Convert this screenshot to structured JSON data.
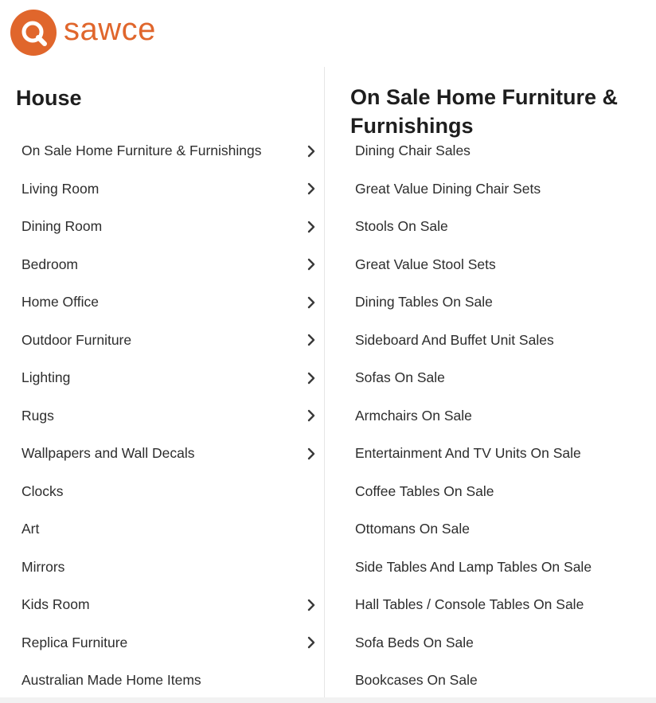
{
  "brand": {
    "name": "sawce",
    "accent": "#e0662c"
  },
  "left_panel": {
    "title": "House",
    "items": [
      {
        "label": "On Sale Home Furniture & Furnishings",
        "has_submenu": true
      },
      {
        "label": "Living Room",
        "has_submenu": true
      },
      {
        "label": "Dining Room",
        "has_submenu": true
      },
      {
        "label": "Bedroom",
        "has_submenu": true
      },
      {
        "label": "Home Office",
        "has_submenu": true
      },
      {
        "label": "Outdoor Furniture",
        "has_submenu": true
      },
      {
        "label": "Lighting",
        "has_submenu": true
      },
      {
        "label": "Rugs",
        "has_submenu": true
      },
      {
        "label": "Wallpapers and Wall Decals",
        "has_submenu": true
      },
      {
        "label": "Clocks",
        "has_submenu": false
      },
      {
        "label": "Art",
        "has_submenu": false
      },
      {
        "label": "Mirrors",
        "has_submenu": false
      },
      {
        "label": "Kids Room",
        "has_submenu": true
      },
      {
        "label": "Replica Furniture",
        "has_submenu": true
      },
      {
        "label": "Australian Made Home Items",
        "has_submenu": false
      }
    ]
  },
  "right_panel": {
    "title": "On Sale Home Furniture & Furnishings",
    "items": [
      "Dining Chair Sales",
      "Great Value Dining Chair Sets",
      "Stools On Sale",
      "Great Value Stool Sets",
      "Dining Tables On Sale",
      "Sideboard And Buffet Unit Sales",
      "Sofas On Sale",
      "Armchairs On Sale",
      "Entertainment And TV Units On Sale",
      "Coffee Tables On Sale",
      "Ottomans On Sale",
      "Side Tables And Lamp Tables On Sale",
      "Hall Tables / Console Tables On Sale",
      "Sofa Beds On Sale",
      "Bookcases On Sale"
    ]
  },
  "icons": {
    "submenu": "chevron-right-icon",
    "logo": "magnifier-logo-icon"
  }
}
